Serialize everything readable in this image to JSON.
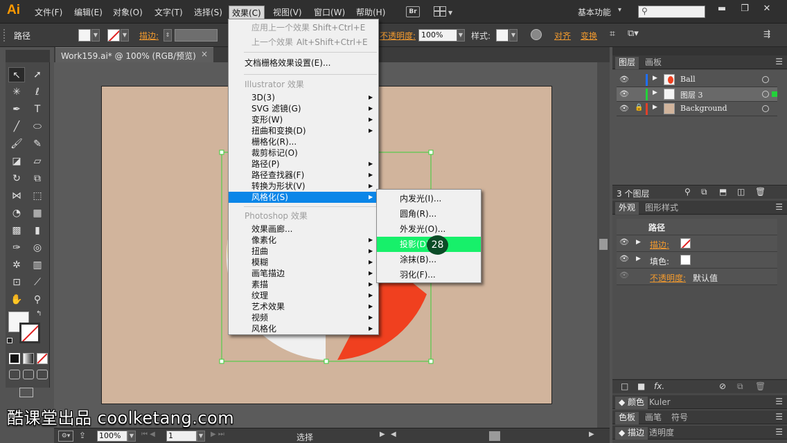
{
  "app": {
    "logo": "Ai",
    "workspace": "基本功能",
    "bridge_label": "Br"
  },
  "menubar": {
    "items": [
      "文件(F)",
      "编辑(E)",
      "对象(O)",
      "文字(T)",
      "选择(S)",
      "效果(C)",
      "视图(V)",
      "窗口(W)",
      "帮助(H)"
    ]
  },
  "controlbar": {
    "path_label": "路径",
    "stroke_label": "描边:",
    "opacity_label": "不透明度:",
    "opacity_value": "100%",
    "style_label": "样式:",
    "align_label": "对齐",
    "transform_label": "变换"
  },
  "document": {
    "tab_title": "Work159.ai* @ 100% (RGB/预览)",
    "close": "×"
  },
  "statusbar": {
    "zoom": "100%",
    "page": "1",
    "tool": "选择"
  },
  "effect_menu": {
    "apply_last": "应用上一个效果",
    "apply_last_shortcut": "Shift+Ctrl+E",
    "last_effect": "上一个效果",
    "last_effect_shortcut": "Alt+Shift+Ctrl+E",
    "raster_settings": "文档栅格效果设置(E)...",
    "illustrator_header": "Illustrator 效果",
    "illustrator_items": [
      "3D(3)",
      "SVG 滤镜(G)",
      "变形(W)",
      "扭曲和变换(D)",
      "栅格化(R)...",
      "裁剪标记(O)",
      "路径(P)",
      "路径查找器(F)",
      "转换为形状(V)",
      "风格化(S)"
    ],
    "photoshop_header": "Photoshop 效果",
    "photoshop_items": [
      "效果画廊...",
      "像素化",
      "扭曲",
      "模糊",
      "画笔描边",
      "素描",
      "纹理",
      "艺术效果",
      "视频",
      "风格化"
    ]
  },
  "stylize_submenu": {
    "items": [
      "内发光(I)...",
      "圆角(R)...",
      "外发光(O)...",
      "投影(D)...",
      "涂抹(B)...",
      "羽化(F)..."
    ],
    "step_badge": "28"
  },
  "layers_panel": {
    "tabs": [
      "图层",
      "画板"
    ],
    "layers": [
      {
        "name": "Ball",
        "color": "#1f6fff"
      },
      {
        "name": "图层 3",
        "color": "#23d23a"
      },
      {
        "name": "Background",
        "color": "#e0402a"
      }
    ],
    "count": "3 个图层"
  },
  "appearance_panel": {
    "tabs": [
      "外观",
      "图形样式"
    ],
    "title": "路径",
    "stroke_label": "描边:",
    "fill_label": "填色:",
    "opacity_label": "不透明度:",
    "opacity_value": "默认值",
    "fx_label": "fx."
  },
  "bottom_panels": {
    "row1": [
      "颜色",
      "Kuler"
    ],
    "row2": [
      "色板",
      "画笔",
      "符号"
    ],
    "row3": [
      "描边",
      "透明度"
    ]
  },
  "watermark": "酷课堂出品 coolketang.com",
  "colors": {
    "artboard": "#d1b49c",
    "accent_orange": "#f29a2e",
    "highlight_blue": "#0b86e8",
    "highlight_green": "#17f06a",
    "ball_red": "#f0401f"
  }
}
